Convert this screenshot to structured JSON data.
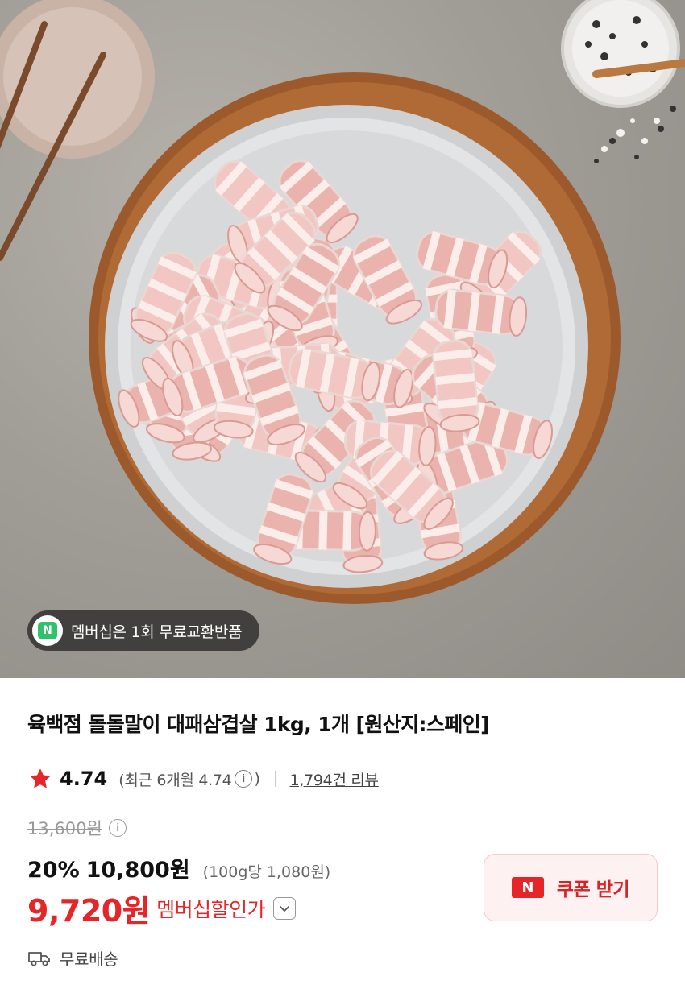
{
  "product_image": {
    "badge_icon_letter": "N",
    "badge_text": "멤버십은 1회 무료교환반품"
  },
  "product": {
    "title": "육백점 돌돌말이 대패삼겹살 1kg, 1개 [원산지:스페인]"
  },
  "rating": {
    "value": "4.74",
    "recent_prefix": "(최근 6개월 4.74",
    "recent_suffix": ")",
    "info_glyph": "i",
    "review_link": "1,794건 리뷰",
    "star_color": "#e52528"
  },
  "pricing": {
    "original_price": "13,600원",
    "discount_rate": "20%",
    "sale_price": "10,800원",
    "unit_price": "(100g당 1,080원)",
    "member_price": "9,720원",
    "member_label": "멤버십할인가"
  },
  "coupon": {
    "icon_letter": "N",
    "label": "쿠폰 받기"
  },
  "shipping": {
    "label": "무료배송",
    "icon": "truck-icon"
  },
  "colors": {
    "accent_red": "#e52528",
    "coupon_bg": "#fdf1f1",
    "badge_green": "#2fc16b"
  }
}
